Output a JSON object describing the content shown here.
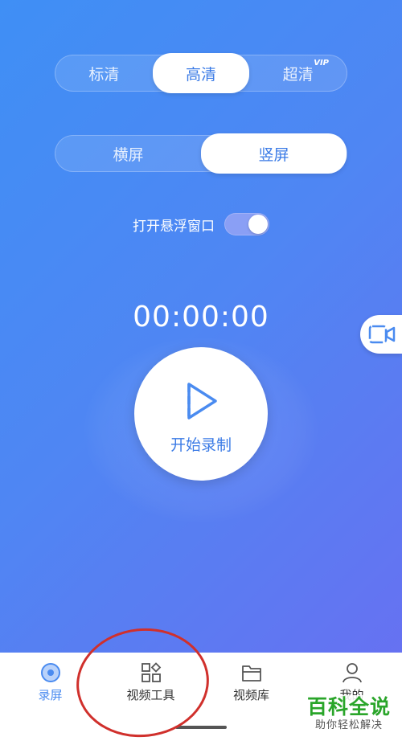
{
  "quality": {
    "options": [
      "标清",
      "高清",
      "超清"
    ],
    "selected": "高清",
    "vip_badge": "VIP"
  },
  "orientation": {
    "options": [
      "横屏",
      "竖屏"
    ],
    "selected": "竖屏"
  },
  "floating_window": {
    "label": "打开悬浮窗口",
    "enabled": true
  },
  "timer": "00:00:00",
  "record_button": {
    "label": "开始录制",
    "icon": "play-icon"
  },
  "side_button": {
    "icon": "video-camera-icon"
  },
  "tabs": [
    {
      "label": "录屏",
      "icon": "record-disc-icon",
      "active": true
    },
    {
      "label": "视频工具",
      "icon": "tools-grid-icon",
      "active": false
    },
    {
      "label": "视频库",
      "icon": "folder-icon",
      "active": false
    },
    {
      "label": "我的",
      "icon": "user-icon",
      "active": false
    }
  ],
  "watermark": {
    "title": "百科全说",
    "subtitle": "助你轻松解决"
  },
  "colors": {
    "accent": "#4a8bf0",
    "background_start": "#3f8ff5",
    "background_end": "#6a6ef1",
    "annotation": "#d0302c",
    "watermark_green": "#2aa52a"
  }
}
